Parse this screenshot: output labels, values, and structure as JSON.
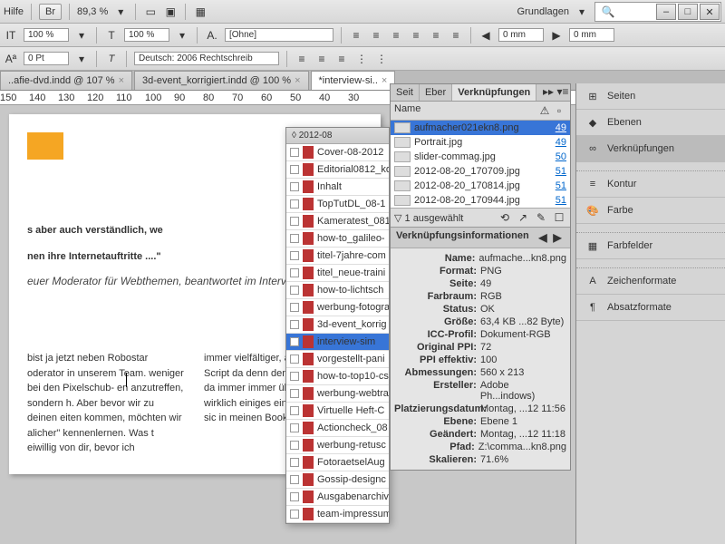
{
  "menu": {
    "help": "Hilfe",
    "br": "Br",
    "zoom": "89,3 %",
    "basics": "Grundlagen"
  },
  "toolbar2": {
    "pct1": "100 %",
    "pct2": "100 %",
    "none": "[Ohne]",
    "pt": "0 Pt",
    "lang": "Deutsch: 2006 Rechtschreib",
    "mm1": "0 mm",
    "mm2": "0 mm"
  },
  "tabs": [
    {
      "label": "..afie-dvd.indd @ 107 %"
    },
    {
      "label": "3d-event_korrigiert.indd @ 100 %"
    },
    {
      "label": "*interview-si.."
    }
  ],
  "ruler": [
    "150",
    "140",
    "130",
    "120",
    "110",
    "100",
    "90",
    "80",
    "70",
    "60",
    "50",
    "40",
    "30"
  ],
  "page": {
    "headline": "s aber auch verständlich, we",
    "headline2": "nen ihre Internetauftritte ....\"",
    "sub": "euer Moderator für Webthemen, beantwortet im Intervie",
    "col1": "bist ja jetzt neben Robostar oderator in unserem Team. weniger bei den Pixelschub- en anzutreffen, sondern h. Aber bevor wir zu deinen eiten kommen, möchten wir alicher\" kennenlernen. Was t eiwillig von dir, bevor ich",
    "col2": "immer vielfältiger, auch diverse Script da denn den Überl Also, um da immer immer überall auf de man wirklich einiges einige Seiten, die sic in meinen Bookmark"
  },
  "book": {
    "title": "◊ 2012-08",
    "items": [
      "Cover-08-2012",
      "Editorial0812_ko",
      "Inhalt",
      "TopTutDL_08-1",
      "Kameratest_081",
      "how-to_galileo-",
      "titel-7jahre-com",
      "titel_neue-traini",
      "how-to-lichtsch",
      "werbung-fotogra",
      "3d-event_korrig",
      "interview-sim",
      "vorgestellt-pani",
      "how-to-top10-cs",
      "werbung-webtra",
      "Virtuelle Heft-C",
      "Actioncheck_08",
      "werbung-retusc",
      "FotoraetselAug",
      "Gossip-designc",
      "Ausgabenarchiv",
      "team-impressum"
    ],
    "sel": 11
  },
  "links": {
    "tabs": [
      "Seit",
      "Eber",
      "Verknüpfungen"
    ],
    "header": "Name",
    "rows": [
      {
        "name": "aufmacher021ekn8.png",
        "pg": "49",
        "sel": true
      },
      {
        "name": "Portrait.jpg",
        "pg": "49"
      },
      {
        "name": "slider-commag.jpg",
        "pg": "50"
      },
      {
        "name": "2012-08-20_170709.jpg",
        "pg": "51"
      },
      {
        "name": "2012-08-20_170814.jpg",
        "pg": "51"
      },
      {
        "name": "2012-08-20_170944.jpg",
        "pg": "51"
      }
    ],
    "selected": "▽ 1 ausgewählt",
    "info_title": "Verknüpfungsinformationen",
    "info": [
      [
        "Name:",
        "aufmache...kn8.png"
      ],
      [
        "Format:",
        "PNG"
      ],
      [
        "Seite:",
        "49"
      ],
      [
        "Farbraum:",
        "RGB"
      ],
      [
        "Status:",
        "OK"
      ],
      [
        "Größe:",
        "63,4 KB ...82 Byte)"
      ],
      [
        "ICC-Profil:",
        "Dokument-RGB"
      ],
      [
        "Original PPI:",
        "72"
      ],
      [
        "PPI effektiv:",
        "100"
      ],
      [
        "Abmessungen:",
        "560 x 213"
      ],
      [
        "Ersteller:",
        "Adobe Ph...indows)"
      ],
      [
        "Platzierungsdatum:",
        "Montag, ...12 11:56"
      ],
      [
        "Ebene:",
        "Ebene 1"
      ],
      [
        "Geändert:",
        "Montag, ...12 11:18"
      ],
      [
        "Pfad:",
        "Z:\\comma...kn8.png"
      ],
      [
        "Skalieren:",
        "71.6%"
      ]
    ]
  },
  "right": [
    {
      "ico": "⊞",
      "label": "Seiten"
    },
    {
      "ico": "◆",
      "label": "Ebenen"
    },
    {
      "ico": "∞",
      "label": "Verknüpfungen",
      "active": true
    },
    {
      "sep": true
    },
    {
      "ico": "≡",
      "label": "Kontur"
    },
    {
      "ico": "🎨",
      "label": "Farbe"
    },
    {
      "sep": true
    },
    {
      "ico": "▦",
      "label": "Farbfelder"
    },
    {
      "sep": true
    },
    {
      "ico": "A",
      "label": "Zeichenformate"
    },
    {
      "ico": "¶",
      "label": "Absatzformate"
    }
  ]
}
